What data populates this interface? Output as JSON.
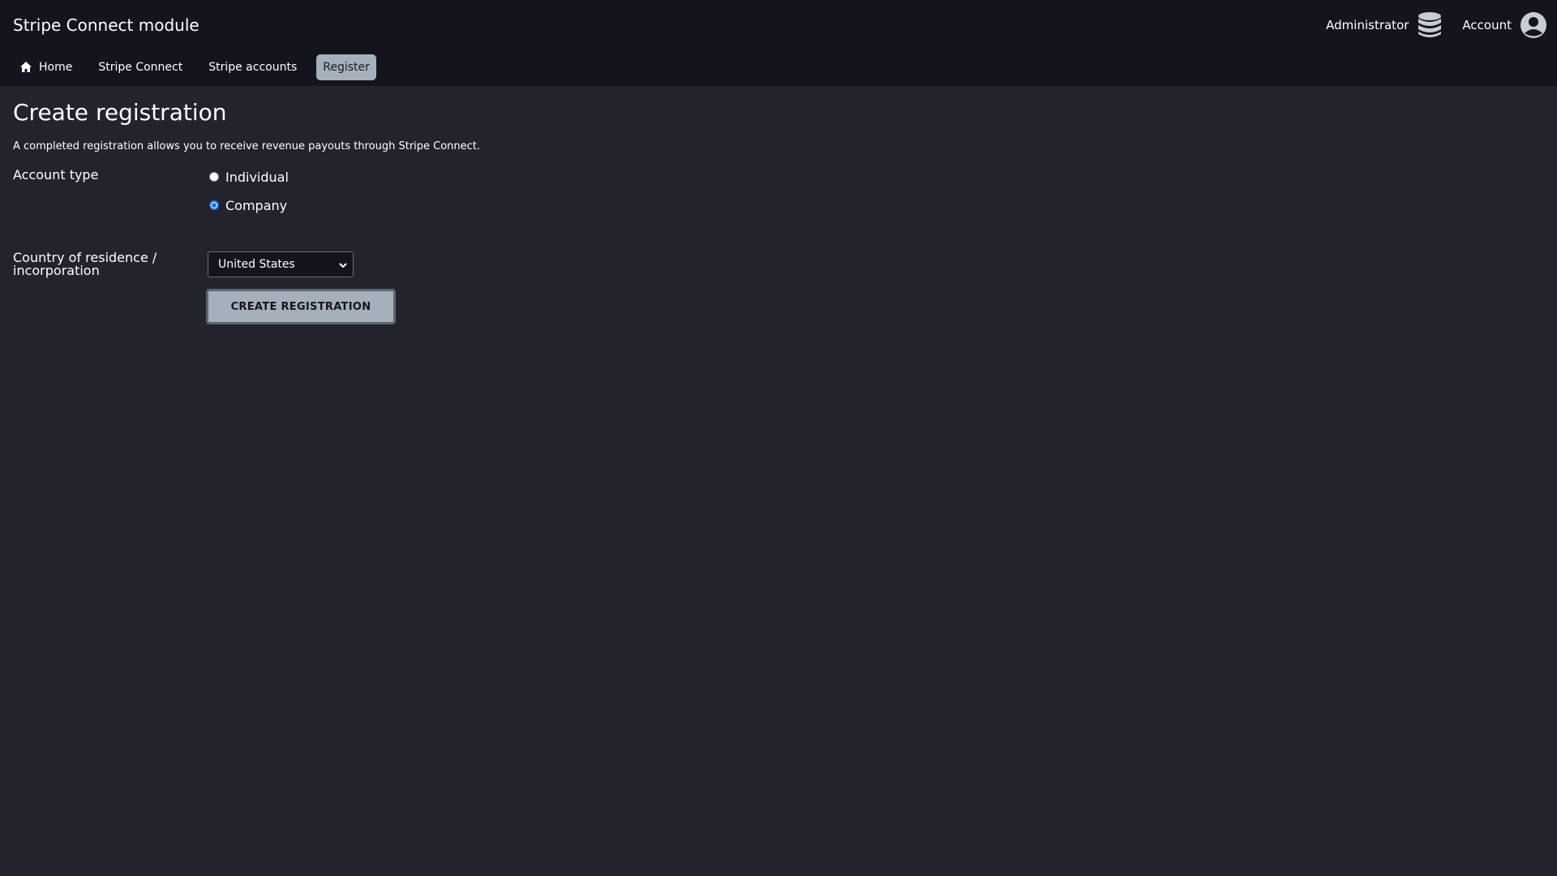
{
  "app": {
    "title": "Stripe Connect module"
  },
  "header": {
    "admin_label": "Administrator",
    "admin_icon": "database-icon",
    "account_label": "Account",
    "account_icon": "user-circle-icon"
  },
  "nav": {
    "items": [
      {
        "label": "Home",
        "icon": "home-icon",
        "active": false
      },
      {
        "label": "Stripe Connect",
        "active": false
      },
      {
        "label": "Stripe accounts",
        "active": false
      },
      {
        "label": "Register",
        "active": true
      }
    ]
  },
  "page": {
    "title": "Create registration",
    "description": "A completed registration allows you to receive revenue payouts through Stripe Connect."
  },
  "form": {
    "account_type_label": "Account type",
    "account_type_options": [
      {
        "label": "Individual",
        "selected": false
      },
      {
        "label": "Company",
        "selected": true
      }
    ],
    "country_label": "Country of residence / incorporation",
    "country_value": "United States",
    "submit_label": "CREATE REGISTRATION"
  },
  "colors": {
    "background": "#22232d",
    "topbar": "#13141e",
    "active_nav": "#a6b0bb",
    "radio_selected": "#1a73e8"
  }
}
